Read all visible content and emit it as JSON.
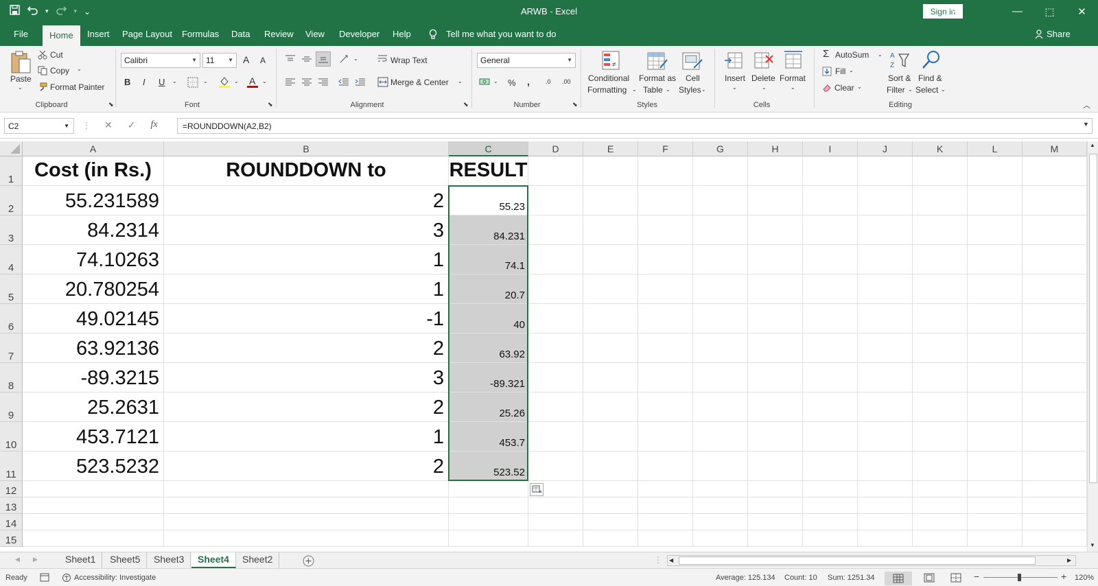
{
  "titlebar": {
    "title": "ARWB  -  Excel",
    "sign_in": "Sign in",
    "qat_more": "⌄",
    "restore_box": "⬚"
  },
  "menu_tabs": [
    "File",
    "Home",
    "Insert",
    "Page Layout",
    "Formulas",
    "Data",
    "Review",
    "View",
    "Developer",
    "Help"
  ],
  "tell_me": "Tell me what you want to do",
  "share": "Share",
  "ribbon": {
    "clipboard": {
      "paste": "Paste",
      "cut": "Cut",
      "copy": "Copy",
      "format_painter": "Format Painter",
      "label": "Clipboard"
    },
    "font": {
      "family": "Calibri",
      "size": "11",
      "bold": "B",
      "italic": "I",
      "underline": "U",
      "grow": "A",
      "shrink": "A",
      "label": "Font"
    },
    "alignment": {
      "wrap_text": "Wrap Text",
      "merge_center": "Merge & Center",
      "label": "Alignment"
    },
    "number": {
      "format": "General",
      "percent": "%",
      "comma": ",",
      "inc_decimal": ".0",
      "dec_decimal": ".00",
      "label": "Number"
    },
    "styles": {
      "conditional": [
        "Conditional",
        "Formatting"
      ],
      "format_table": [
        "Format as",
        "Table"
      ],
      "cell_styles": [
        "Cell",
        "Styles"
      ],
      "label": "Styles"
    },
    "cells": {
      "insert": "Insert",
      "delete": "Delete",
      "format": "Format",
      "label": "Cells"
    },
    "editing": {
      "autosum": "AutoSum",
      "fill": "Fill",
      "clear": "Clear",
      "sort_filter": [
        "Sort &",
        "Filter"
      ],
      "find_select": [
        "Find &",
        "Select"
      ],
      "label": "Editing"
    }
  },
  "formula_bar": {
    "name_box": "C2",
    "formula": "=ROUNDDOWN(A2,B2)",
    "cancel": "✕",
    "enter": "✓",
    "fx": "fx"
  },
  "columns": [
    "A",
    "B",
    "C",
    "D",
    "E",
    "F",
    "G",
    "H",
    "I",
    "J",
    "K",
    "L",
    "M"
  ],
  "rows": [
    "1",
    "2",
    "3",
    "4",
    "5",
    "6",
    "7",
    "8",
    "9",
    "10",
    "11",
    "12",
    "13",
    "14",
    "15"
  ],
  "table": {
    "headers": [
      "Cost (in Rs.)",
      "ROUNDDOWN to",
      "RESULT"
    ],
    "rows": [
      [
        "55.231589",
        "2",
        "55.23"
      ],
      [
        "84.2314",
        "3",
        "84.231"
      ],
      [
        "74.10263",
        "1",
        "74.1"
      ],
      [
        "20.780254",
        "1",
        "20.7"
      ],
      [
        "49.02145",
        "-1",
        "40"
      ],
      [
        "63.92136",
        "2",
        "63.92"
      ],
      [
        "-89.3215",
        "3",
        "-89.321"
      ],
      [
        "25.2631",
        "2",
        "25.26"
      ],
      [
        "453.7121",
        "1",
        "453.7"
      ],
      [
        "523.5232",
        "2",
        "523.52"
      ]
    ]
  },
  "sheets": [
    "Sheet1",
    "Sheet5",
    "Sheet3",
    "Sheet4",
    "Sheet2"
  ],
  "active_sheet": "Sheet4",
  "status": {
    "ready": "Ready",
    "accessibility": "Accessibility: Investigate",
    "average": "Average: 125.134",
    "count": "Count: 10",
    "sum": "Sum: 1251.34",
    "zoom": "120%",
    "zoom_minus": "−",
    "zoom_plus": "+"
  },
  "colors": {
    "excel_green": "#217346",
    "ribbon_bg": "#f3f3f3",
    "selection_fill": "#d0d0d0"
  }
}
